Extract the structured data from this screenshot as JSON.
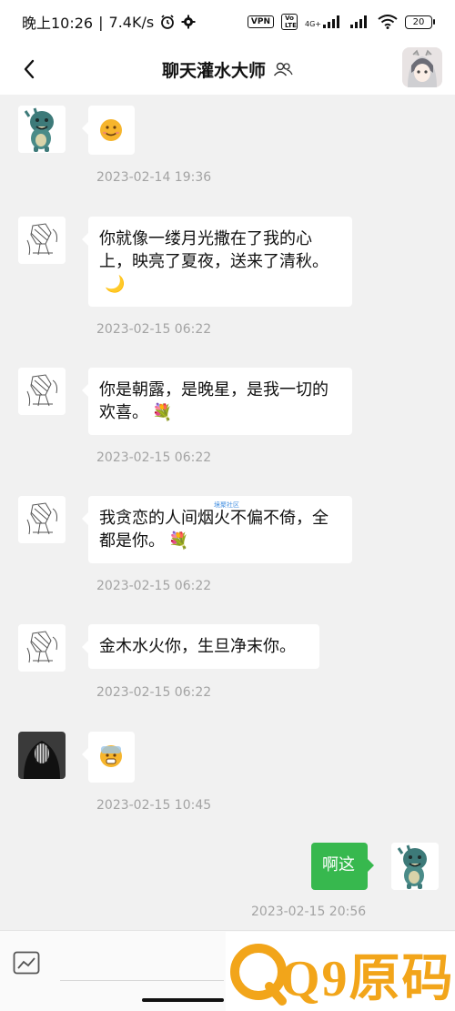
{
  "status_bar": {
    "time": "晚上10:26",
    "speed": "7.4K/s",
    "vpn": "VPN",
    "volte": "Vo LTE",
    "network": "4G+",
    "battery": "20"
  },
  "header": {
    "title": "聊天灌水大师"
  },
  "messages": [
    {
      "text": "",
      "icon": "smile-emoji",
      "timestamp": "2023-02-14 19:36"
    },
    {
      "text": "你就像一缕月光撒在了我的心上，映亮了夏夜，送来了清秋。",
      "emoji": "🌙",
      "timestamp": "2023-02-15 06:22"
    },
    {
      "text": "你是朝露，是晚星，是我一切的欢喜。",
      "emoji": "💐",
      "timestamp": "2023-02-15 06:22"
    },
    {
      "text": "我贪恋的人间烟火不偏不倚，全都是你。",
      "emoji": "💐",
      "tag": "境聚社区",
      "timestamp": "2023-02-15 06:22"
    },
    {
      "text": "金木水火你，生旦净末你。",
      "timestamp": "2023-02-15 06:22"
    },
    {
      "text": "",
      "icon": "fearful-emoji",
      "timestamp": "2023-02-15 10:45"
    },
    {
      "text": "啊这",
      "mine": true,
      "timestamp": "2023-02-15 20:56"
    }
  ],
  "watermark": "Q9原码",
  "colors": {
    "accent_green": "#37b84e",
    "timestamp_gray": "#a3a3a3",
    "background": "#f1f1f1"
  }
}
